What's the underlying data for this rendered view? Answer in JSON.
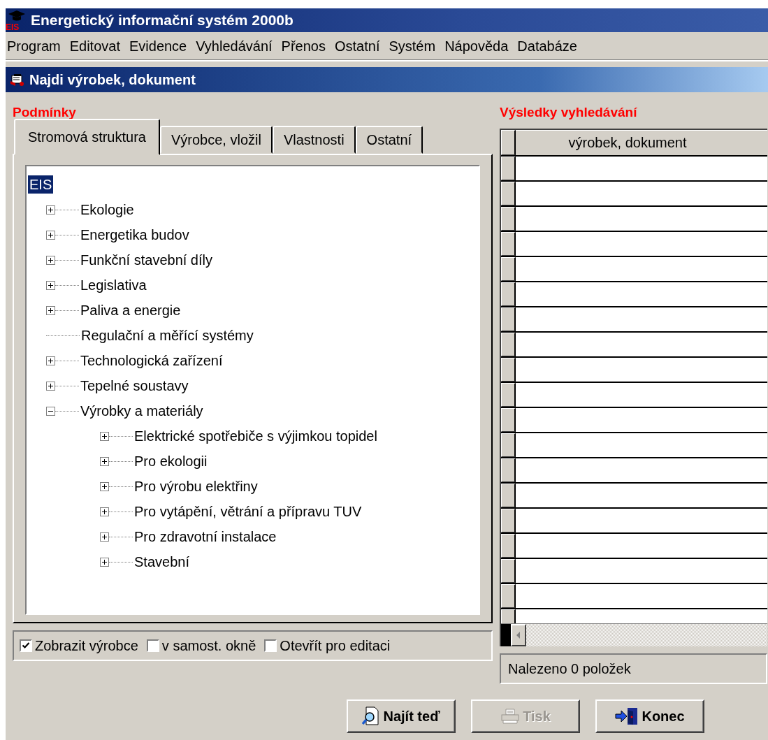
{
  "window": {
    "logo_text": "EIS",
    "title": "Energetický informační systém 2000b"
  },
  "menu": [
    "Program",
    "Editovat",
    "Evidence",
    "Vyhledávání",
    "Přenos",
    "Ostatní",
    "Systém",
    "Nápověda",
    "Databáze"
  ],
  "dialog": {
    "title": "Najdi výrobek, dokument"
  },
  "conditions": {
    "heading": "Podmínky",
    "tabs": [
      {
        "label": "Stromová struktura",
        "selected": true
      },
      {
        "label": "Výrobce, vložil",
        "selected": false
      },
      {
        "label": "Vlastnosti",
        "selected": false
      },
      {
        "label": "Ostatní",
        "selected": false
      }
    ],
    "tree": {
      "label": "EIS",
      "selected": true,
      "children": [
        {
          "label": "Ekologie",
          "expandable": true,
          "expanded": false
        },
        {
          "label": "Energetika budov",
          "expandable": true,
          "expanded": false
        },
        {
          "label": "Funkční stavební díly",
          "expandable": true,
          "expanded": false
        },
        {
          "label": "Legislativa",
          "expandable": true,
          "expanded": false
        },
        {
          "label": "Paliva a energie",
          "expandable": true,
          "expanded": false
        },
        {
          "label": "Regulační a měřící systémy",
          "expandable": false
        },
        {
          "label": "Technologická zařízení",
          "expandable": true,
          "expanded": false
        },
        {
          "label": "Tepelné soustavy",
          "expandable": true,
          "expanded": false
        },
        {
          "label": "Výrobky a materiály",
          "expandable": true,
          "expanded": true,
          "children": [
            {
              "label": "Elektrické spotřebiče s výjimkou topidel",
              "expandable": true,
              "expanded": false
            },
            {
              "label": "Pro ekologii",
              "expandable": true,
              "expanded": false
            },
            {
              "label": "Pro výrobu elektřiny",
              "expandable": true,
              "expanded": false
            },
            {
              "label": "Pro vytápění, větrání a přípravu TUV",
              "expandable": true,
              "expanded": false
            },
            {
              "label": "Pro zdravotní instalace",
              "expandable": true,
              "expanded": false
            },
            {
              "label": "Stavební",
              "expandable": true,
              "expanded": false
            }
          ]
        }
      ]
    },
    "options": [
      {
        "label": "Zobrazit výrobce",
        "checked": true
      },
      {
        "label": "v samost. okně",
        "checked": false
      },
      {
        "label": "Otevřít pro editaci",
        "checked": false
      }
    ]
  },
  "results": {
    "heading": "Výsledky vyhledávání",
    "columns": [
      "výrobek, dokument"
    ],
    "status": "Nalezeno 0 položek"
  },
  "buttons": [
    {
      "kind": "find",
      "label": "Najít teď",
      "disabled": false
    },
    {
      "kind": "print",
      "label": "Tisk",
      "disabled": true
    },
    {
      "kind": "exit",
      "label": "Konec",
      "disabled": false
    }
  ]
}
